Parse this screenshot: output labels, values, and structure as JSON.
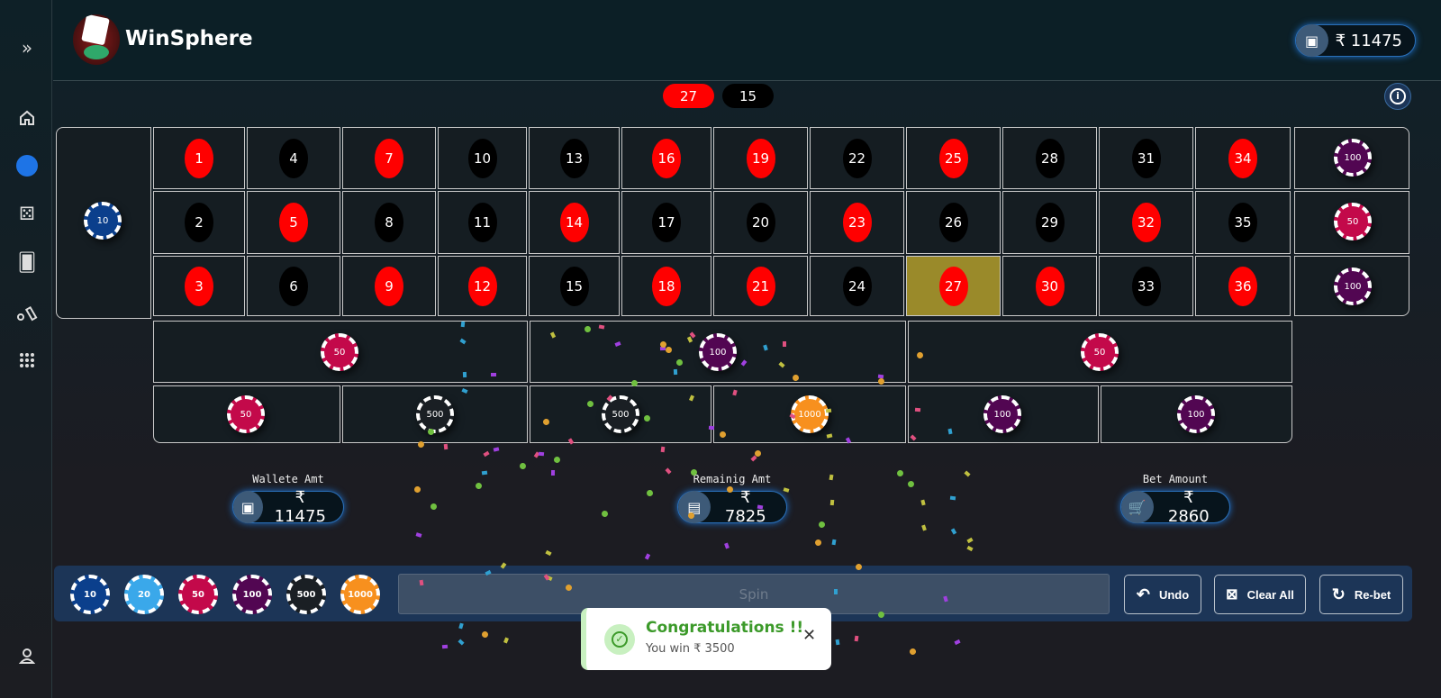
{
  "app": {
    "title": "WinSphere",
    "header_balance": "₹ 11475"
  },
  "sidebar": {
    "items": [
      {
        "icon": "expand-icon"
      },
      {
        "icon": "home-icon"
      },
      {
        "icon": "roulette-icon",
        "active": true
      },
      {
        "icon": "dice-icon"
      },
      {
        "icon": "cards-icon"
      },
      {
        "icon": "cricket-icon"
      },
      {
        "icon": "apps-grid-icon"
      },
      {
        "icon": "user-icon"
      }
    ]
  },
  "history": [
    {
      "value": "27",
      "color": "#ff0000"
    },
    {
      "value": "15",
      "color": "#000000"
    }
  ],
  "colors": {
    "red": "#ff0000",
    "black": "#000000",
    "highlight": "#9a8a2a",
    "bar": "#1c3557",
    "success": "#3c9a2a"
  },
  "board": {
    "rows": [
      [
        "1",
        "4",
        "7",
        "10",
        "13",
        "16",
        "19",
        "22",
        "25",
        "28",
        "31",
        "34"
      ],
      [
        "2",
        "5",
        "8",
        "11",
        "14",
        "17",
        "20",
        "23",
        "26",
        "29",
        "32",
        "35"
      ],
      [
        "3",
        "6",
        "9",
        "12",
        "15",
        "18",
        "21",
        "24",
        "27",
        "30",
        "33",
        "36"
      ]
    ],
    "red": [
      "1",
      "3",
      "5",
      "7",
      "9",
      "12",
      "14",
      "16",
      "18",
      "19",
      "21",
      "23",
      "25",
      "27",
      "30",
      "32",
      "34",
      "36"
    ],
    "winning": "27",
    "zero_chip": "10",
    "column_chips": [
      "100",
      "50",
      "100"
    ],
    "dozen_chips": [
      "50",
      "100",
      "50"
    ],
    "outside_chips": [
      "50",
      "500",
      "500",
      "1000",
      "100",
      "100"
    ]
  },
  "stats": {
    "wallet_label": "Wallete Amt",
    "wallet": "₹ 11475",
    "remaining_label": "Remainig Amt",
    "remaining": "₹ 7825",
    "bet_label": "Bet Amount",
    "bet": "₹ 2860"
  },
  "chips": [
    {
      "v": "10",
      "c": "#0b3f8c"
    },
    {
      "v": "20",
      "c": "#3aa8ea"
    },
    {
      "v": "50",
      "c": "#c3094a"
    },
    {
      "v": "100",
      "c": "#520652"
    },
    {
      "v": "500",
      "c": "#1a1f24"
    },
    {
      "v": "1000",
      "c": "#f7901e"
    }
  ],
  "controls": {
    "spin_placeholder": "Spin",
    "undo": "Undo",
    "clear": "Clear All",
    "rebet": "Re-bet"
  },
  "toast": {
    "title": "Congratulations !!",
    "message": "You win ₹ 3500"
  }
}
